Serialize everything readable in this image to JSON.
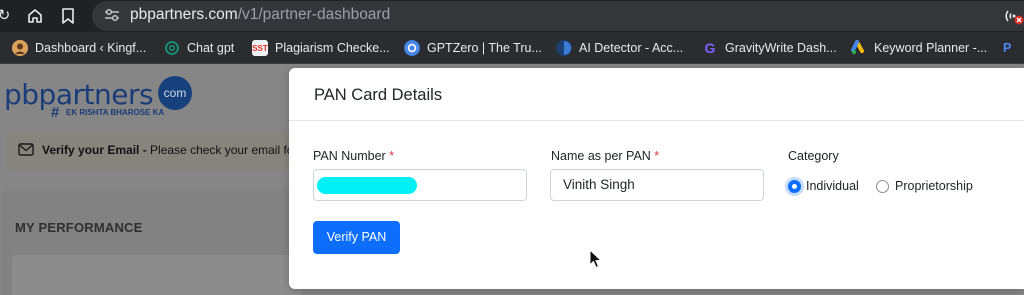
{
  "browser": {
    "url_host": "pbpartners.com",
    "url_path": "/v1/partner-dashboard",
    "bookmarks": [
      {
        "label": "Dashboard ‹ Kingf...",
        "icon": "avatar-icon"
      },
      {
        "label": "Chat gpt",
        "icon": "openai-icon"
      },
      {
        "label": "Plagiarism Checke...",
        "icon": "sst-icon",
        "badge": "SST"
      },
      {
        "label": "GPTZero | The Tru...",
        "icon": "gptzero-icon"
      },
      {
        "label": "AI Detector - Acc...",
        "icon": "detector-icon"
      },
      {
        "label": "GravityWrite Dash...",
        "icon": "gravitywrite-icon"
      },
      {
        "label": "Keyword Planner -...",
        "icon": "google-ads-icon"
      }
    ]
  },
  "page": {
    "logo_text": "pbpartners",
    "logo_suffix": "com",
    "tagline": "EK RISHTA BHAROSE KA",
    "verify_banner": {
      "bold": "Verify your Email -",
      "text": " Please check your email for"
    },
    "performance_title": "MY PERFORMANCE"
  },
  "modal": {
    "title": "PAN Card Details",
    "pan_number": {
      "label": "PAN Number",
      "required_mark": "*",
      "value": ""
    },
    "name_as_per_pan": {
      "label": "Name as per PAN",
      "required_mark": "*",
      "value": "Vinith Singh"
    },
    "category": {
      "label": "Category",
      "options": [
        {
          "label": "Individual",
          "checked": true
        },
        {
          "label": "Proprietorship",
          "checked": false
        }
      ]
    },
    "verify_button": "Verify PAN"
  },
  "colors": {
    "primary": "#0d6efd",
    "required": "#dc3545",
    "redaction": "#00f0f5",
    "brand": "#1a3c78"
  }
}
